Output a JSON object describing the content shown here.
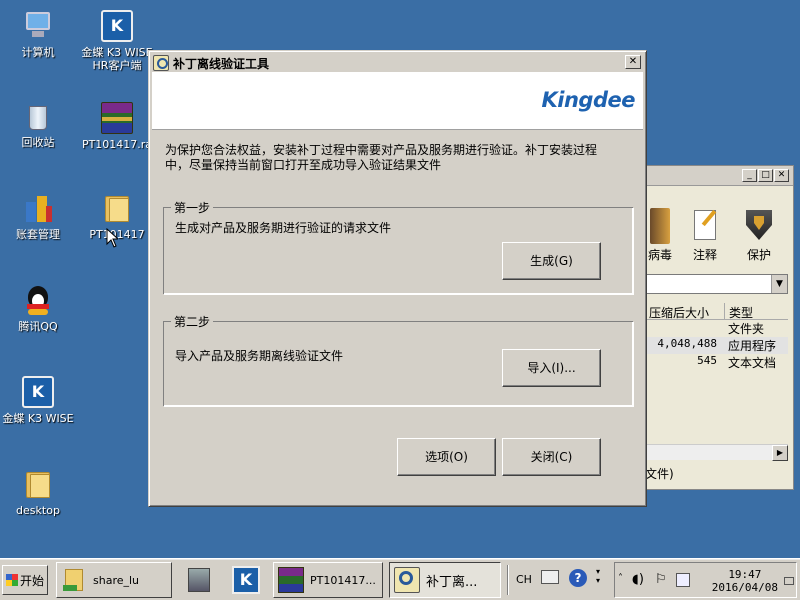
{
  "desktop": {
    "icons": [
      {
        "label": "计算机",
        "icon": "computer-icon"
      },
      {
        "label": "金蝶 K3 WISE\nHR客户端",
        "icon": "k3-hr-client-icon"
      },
      {
        "label": "回收站",
        "icon": "recycle-bin-icon"
      },
      {
        "label": "PT101417.ra",
        "icon": "rar-archive-icon"
      },
      {
        "label": "账套管理",
        "icon": "account-management-icon"
      },
      {
        "label": "PT101417",
        "icon": "folder-icon"
      },
      {
        "label": "腾讯QQ",
        "icon": "qq-icon"
      },
      {
        "label": "金蝶 K3 WISE",
        "icon": "k3-wise-icon"
      },
      {
        "label": "desktop",
        "icon": "folder-icon"
      }
    ]
  },
  "background_window": {
    "toolbar": [
      {
        "label": "病毒",
        "icon": "antivirus-icon"
      },
      {
        "label": "注释",
        "icon": "comment-icon"
      },
      {
        "label": "保护",
        "icon": "protect-shield-icon"
      }
    ],
    "columns": [
      "压缩后大小",
      "类型"
    ],
    "rows": [
      {
        "size": "",
        "type": "文件夹"
      },
      {
        "size": "4,048,488",
        "type": "应用程序"
      },
      {
        "size": "545",
        "type": "文本文档"
      }
    ],
    "status_text": "文件)"
  },
  "dialog": {
    "title": "补丁离线验证工具",
    "logo_text": "Kingdee",
    "intro": "为保护您合法权益，安装补丁过程中需要对产品及服务期进行验证。补丁安装过程中，尽量保持当前窗口打开至成功导入验证结果文件",
    "step1": {
      "label": "第一步",
      "text": "生成对产品及服务期进行验证的请求文件",
      "button": "生成(G)"
    },
    "step2": {
      "label": "第二步",
      "text": "导入产品及服务期离线验证文件",
      "button": "导入(I)..."
    },
    "options_button": "选项(O)",
    "close_button": "关闭(C)"
  },
  "taskbar": {
    "start_label": "开始",
    "tasks": [
      {
        "label": "share_lu",
        "icon": "folder-icon"
      },
      {
        "label": "PT101417...",
        "icon": "rar-archive-icon"
      },
      {
        "label": "补丁离...",
        "icon": "magnifier-icon"
      }
    ],
    "language": "CH",
    "time": "19:47",
    "date": "2016/04/08"
  }
}
